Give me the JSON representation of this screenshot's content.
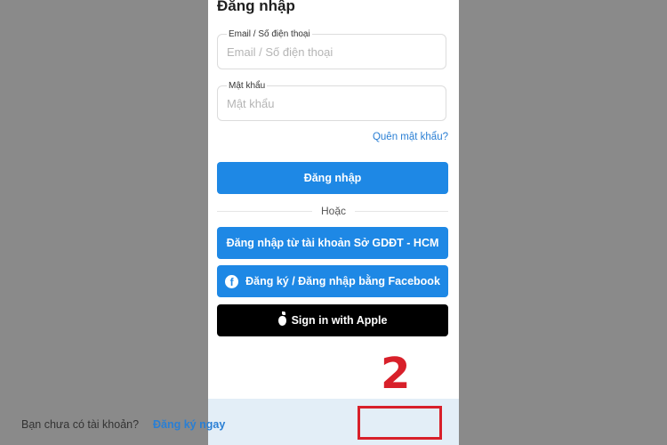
{
  "login": {
    "title": "Đăng nhập",
    "email_label": "Email / Số điện thoại",
    "email_placeholder": "Email / Số điện thoại",
    "password_label": "Mật khẩu",
    "password_placeholder": "Mật khẩu",
    "forgot_link": "Quên mật khẩu?",
    "login_button": "Đăng nhập",
    "or_text": "Hoặc",
    "sgddt_button": "Đăng nhập từ tài khoản Sở GDĐT - HCM",
    "facebook_button": "Đăng ký / Đăng nhập bằng Facebook",
    "facebook_icon_letter": "f",
    "apple_button": "Sign in with Apple",
    "no_account_text": "Bạn chưa có tài khoản?",
    "register_link": "Đăng ký ngay"
  },
  "annotation": {
    "step_number": "2"
  },
  "colors": {
    "primary_blue": "#1e88e5",
    "link_blue": "#2a7fd4",
    "highlight_red": "#d8202a",
    "bottom_bar": "#e3eef7"
  },
  "icons": {
    "facebook": "facebook-icon",
    "apple": "apple-icon"
  }
}
